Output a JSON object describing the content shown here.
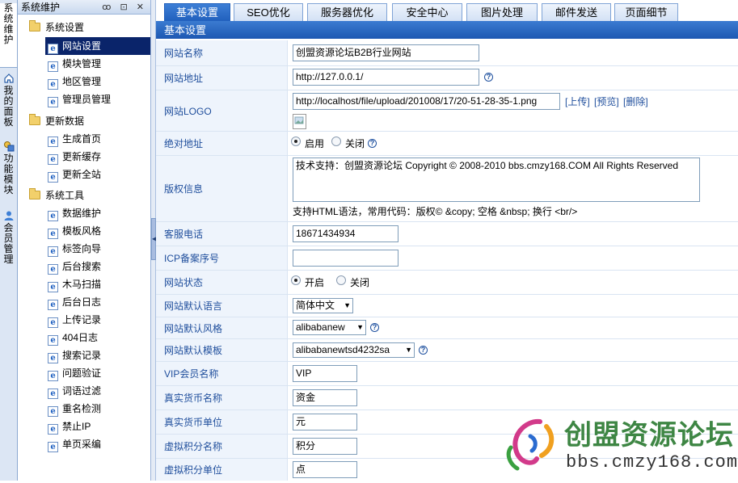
{
  "rail": {
    "items": [
      {
        "label": "系统维护",
        "icon": "settings-icon"
      },
      {
        "label": "我的面板",
        "icon": "home-icon"
      },
      {
        "label": "功能模块",
        "icon": "module-icon"
      },
      {
        "label": "会员管理",
        "icon": "user-icon"
      }
    ]
  },
  "sidebar": {
    "title": "系统维护",
    "pins": "ꝏ ⊡ ✕",
    "groups": [
      {
        "label": "系统设置",
        "items": [
          "网站设置",
          "模块管理",
          "地区管理",
          "管理员管理"
        ]
      },
      {
        "label": "更新数据",
        "items": [
          "生成首页",
          "更新缓存",
          "更新全站"
        ]
      },
      {
        "label": "系统工具",
        "items": [
          "数据维护",
          "模板风格",
          "标签向导",
          "后台搜索",
          "木马扫描",
          "后台日志",
          "上传记录",
          "404日志",
          "搜索记录",
          "问题验证",
          "词语过滤",
          "重名检测",
          "禁止IP",
          "单页采编"
        ]
      }
    ],
    "selected": "网站设置"
  },
  "tabs": [
    "基本设置",
    "SEO优化",
    "服务器优化",
    "安全中心",
    "图片处理",
    "邮件发送",
    "页面细节"
  ],
  "section_title": "基本设置",
  "form": {
    "site_name": {
      "label": "网站名称",
      "value": "创盟资源论坛B2B行业网站"
    },
    "site_url": {
      "label": "网站地址",
      "value": "http://127.0.0.1/"
    },
    "site_logo": {
      "label": "网站LOGO",
      "value": "http://localhost/file/upload/201008/17/20-51-28-35-1.png",
      "upload": "[上传]",
      "preview": "[预览]",
      "delete": "[删除]"
    },
    "abs_url": {
      "label": "绝对地址",
      "on": "启用",
      "off": "关闭",
      "selected": "on"
    },
    "copyright": {
      "label": "版权信息",
      "value": "技术支持：创盟资源论坛 Copyright © 2008-2010  bbs.cmzy168.COM All Rights Reserved",
      "hint": "支持HTML语法，常用代码：版权© &copy; 空格 &nbsp; 换行 <br/>"
    },
    "phone": {
      "label": "客服电话",
      "value": "18671434934"
    },
    "icp": {
      "label": "ICP备案序号",
      "value": ""
    },
    "status": {
      "label": "网站状态",
      "on": "开启",
      "off": "关闭",
      "selected": "on"
    },
    "language": {
      "label": "网站默认语言",
      "value": "简体中文"
    },
    "style": {
      "label": "网站默认风格",
      "value": "alibabanew"
    },
    "template": {
      "label": "网站默认模板",
      "value": "alibabanewtsd4232sa"
    },
    "vip_name": {
      "label": "VIP会员名称",
      "value": "VIP"
    },
    "money_name": {
      "label": "真实货币名称",
      "value": "资金"
    },
    "money_unit": {
      "label": "真实货币单位",
      "value": "元"
    },
    "credit_name": {
      "label": "虚拟积分名称",
      "value": "积分"
    },
    "credit_unit": {
      "label": "虚拟积分单位",
      "value": "点"
    }
  },
  "watermark": {
    "title": "创盟资源论坛",
    "url": "bbs.cmzy168.com"
  },
  "colors": {
    "accent": "#1d58b2",
    "label_text": "#1f4e9c",
    "label_bg": "#eef4fc",
    "selected": "#0a246a"
  }
}
